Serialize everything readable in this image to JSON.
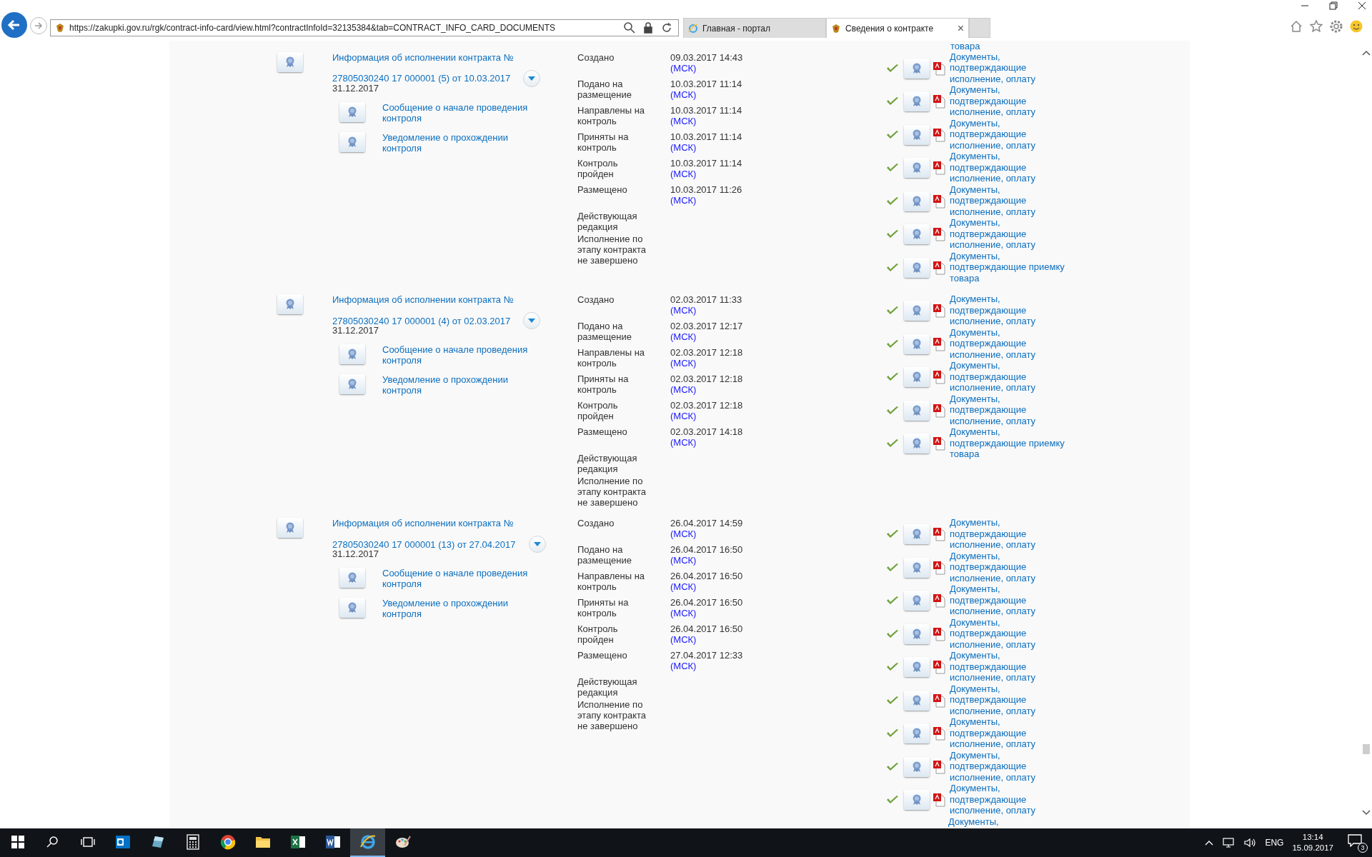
{
  "browser": {
    "url": "https://zakupki.gov.ru/rgk/contract-info-card/view.html?contractInfoId=32135384&tab=CONTRACT_INFO_CARD_DOCUMENTS",
    "tabs": [
      {
        "label": "Главная - портал",
        "selected": false
      },
      {
        "label": "Сведения о контракте",
        "selected": true
      }
    ],
    "close_tab": "×"
  },
  "cut_top_document": "товара",
  "sections": [
    {
      "title": "Информация об исполнении контракта №",
      "number": "27805030240 17 000001 (5) от 10.03.2017",
      "date": "31.12.2017",
      "sub_items": [
        "Сообщение о начале проведения контроля",
        "Уведомление о прохождении контроля"
      ],
      "statuses": [
        {
          "label": "Создано",
          "value": "09.03.2017 14:43",
          "tz": "(МСК)"
        },
        {
          "label": "Подано на размещение",
          "value": "10.03.2017 11:14",
          "tz": "(МСК)"
        },
        {
          "label": "Направлены на контроль",
          "value": "10.03.2017 11:14",
          "tz": "(МСК)"
        },
        {
          "label": "Приняты на контроль",
          "value": "10.03.2017 11:14",
          "tz": "(МСК)"
        },
        {
          "label": "Контроль пройден",
          "value": "10.03.2017 11:14",
          "tz": "(МСК)"
        },
        {
          "label": "Размещено",
          "value": "10.03.2017 11:26",
          "tz": "(МСК)"
        }
      ],
      "notes": [
        "Действующая редакция",
        "Исполнение по этапу контракта не завершено"
      ],
      "documents": [
        "Документы, подтверждающие исполнение, оплату",
        "Документы, подтверждающие исполнение, оплату",
        "Документы, подтверждающие исполнение, оплату",
        "Документы, подтверждающие исполнение, оплату",
        "Документы, подтверждающие исполнение, оплату",
        "Документы, подтверждающие исполнение, оплату",
        "Документы, подтверждающие приемку товара"
      ]
    },
    {
      "title": "Информация об исполнении контракта №",
      "number": "27805030240 17 000001 (4) от 02.03.2017",
      "date": "31.12.2017",
      "sub_items": [
        "Сообщение о начале проведения контроля",
        "Уведомление о прохождении контроля"
      ],
      "statuses": [
        {
          "label": "Создано",
          "value": "02.03.2017 11:33",
          "tz": "(МСК)"
        },
        {
          "label": "Подано на размещение",
          "value": "02.03.2017 12:17",
          "tz": "(МСК)"
        },
        {
          "label": "Направлены на контроль",
          "value": "02.03.2017 12:18",
          "tz": "(МСК)"
        },
        {
          "label": "Приняты на контроль",
          "value": "02.03.2017 12:18",
          "tz": "(МСК)"
        },
        {
          "label": "Контроль пройден",
          "value": "02.03.2017 12:18",
          "tz": "(МСК)"
        },
        {
          "label": "Размещено",
          "value": "02.03.2017 14:18",
          "tz": "(МСК)"
        }
      ],
      "notes": [
        "Действующая редакция",
        "Исполнение по этапу контракта не завершено"
      ],
      "documents": [
        "Документы, подтверждающие исполнение, оплату",
        "Документы, подтверждающие исполнение, оплату",
        "Документы, подтверждающие исполнение, оплату",
        "Документы, подтверждающие исполнение, оплату",
        "Документы, подтверждающие приемку товара"
      ]
    },
    {
      "title": "Информация об исполнении контракта №",
      "number": "27805030240 17 000001 (13) от 27.04.2017",
      "date": "31.12.2017",
      "sub_items": [
        "Сообщение о начале проведения контроля",
        "Уведомление о прохождении контроля"
      ],
      "statuses": [
        {
          "label": "Создано",
          "value": "26.04.2017 14:59",
          "tz": "(МСК)"
        },
        {
          "label": "Подано на размещение",
          "value": "26.04.2017 16:50",
          "tz": "(МСК)"
        },
        {
          "label": "Направлены на контроль",
          "value": "26.04.2017 16:50",
          "tz": "(МСК)"
        },
        {
          "label": "Приняты на контроль",
          "value": "26.04.2017 16:50",
          "tz": "(МСК)"
        },
        {
          "label": "Контроль пройден",
          "value": "26.04.2017 16:50",
          "tz": "(МСК)"
        },
        {
          "label": "Размещено",
          "value": "27.04.2017 12:33",
          "tz": "(МСК)"
        }
      ],
      "notes": [
        "Действующая редакция",
        "Исполнение по этапу контракта не завершено"
      ],
      "documents": [
        "Документы, подтверждающие исполнение, оплату",
        "Документы, подтверждающие исполнение, оплату",
        "Документы, подтверждающие исполнение, оплату",
        "Документы, подтверждающие исполнение, оплату",
        "Документы, подтверждающие исполнение, оплату",
        "Документы, подтверждающие исполнение, оплату",
        "Документы, подтверждающие исполнение, оплату",
        "Документы, подтверждающие исполнение, оплату",
        "Документы, подтверждающие исполнение, оплату"
      ],
      "cut_bottom_document": "Документы,"
    }
  ],
  "taskbar": {
    "apps": [
      {
        "selected": false
      },
      {
        "selected": false
      },
      {
        "selected": false
      },
      {
        "selected": false
      },
      {
        "selected": false
      },
      {
        "selected": false
      },
      {
        "selected": false
      },
      {
        "selected": true
      },
      {
        "selected": false
      }
    ],
    "language": "ENG",
    "time": "13:14",
    "date": "15.09.2017",
    "notifications": "3"
  }
}
